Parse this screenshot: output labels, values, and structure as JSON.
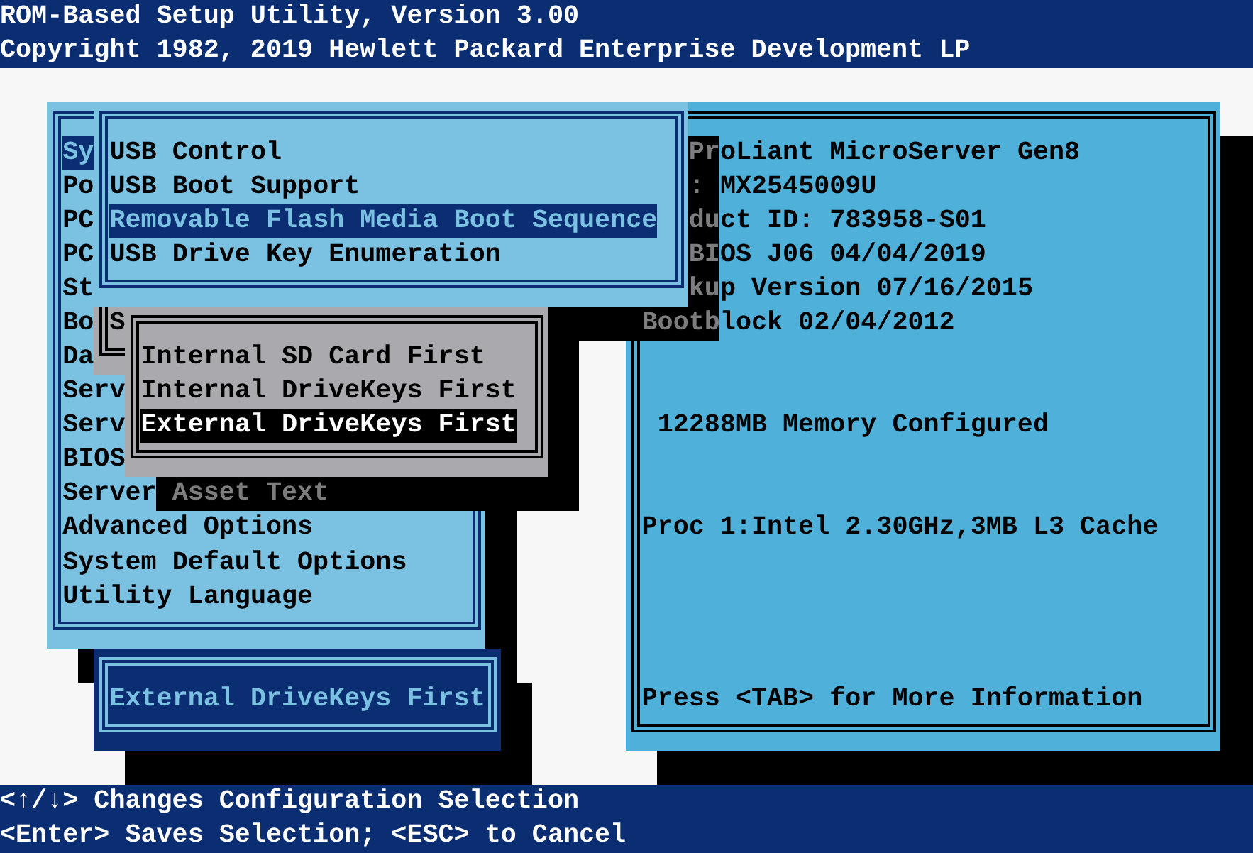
{
  "title_bar": {
    "lines": [
      "ROM-Based Setup Utility, Version 3.00",
      "Copyright 1982, 2019 Hewlett Packard Enterprise Development LP"
    ]
  },
  "main_menu": {
    "items": [
      {
        "label": "Sy",
        "selected": true
      },
      {
        "label": "Po",
        "selected": false
      },
      {
        "label": "PC",
        "selected": false
      },
      {
        "label": "PC",
        "selected": false
      },
      {
        "label": "St",
        "selected": false
      },
      {
        "label": "Bo",
        "selected": false
      },
      {
        "label": "Da",
        "selected": false
      },
      {
        "label": "Serv",
        "selected": false
      },
      {
        "label": "Serv",
        "selected": false
      },
      {
        "label": "BIOS",
        "selected": false
      },
      {
        "label": "Server Asset Text",
        "selected": false
      },
      {
        "label": "Advanced Options",
        "selected": false
      },
      {
        "label": "System Default Options",
        "selected": false
      },
      {
        "label": "Utility Language",
        "selected": false
      }
    ]
  },
  "usb_submenu": {
    "items": [
      {
        "label": "USB Control",
        "selected": false
      },
      {
        "label": "USB Boot Support",
        "selected": false
      },
      {
        "label": "Removable Flash Media Boot Sequence",
        "selected": true
      },
      {
        "label": "USB Drive Key Enumeration",
        "selected": false
      }
    ]
  },
  "partial_window": {
    "text": "S"
  },
  "options_popup": {
    "options": [
      {
        "label": "Internal SD Card First",
        "selected": false
      },
      {
        "label": "Internal DriveKeys First",
        "selected": false
      },
      {
        "label": "External DriveKeys First",
        "selected": true
      }
    ]
  },
  "value_box": {
    "text": "External DriveKeys First"
  },
  "info_panel": {
    "lines": [
      "ProLiant MicroServer Gen8",
      ": MX2545009U",
      "duct ID: 783958-S01",
      "BIOS J06 04/04/2019",
      "kup Version 07/16/2015",
      "Bootblock 02/04/2012",
      "12288MB Memory Configured",
      "Proc 1:Intel 2.30GHz,3MB L3 Cache",
      "Press <TAB> for More Information"
    ]
  },
  "help_bar": {
    "lines": [
      "<↑/↓> Changes Configuration Selection",
      "<Enter> Saves Selection; <ESC> to Cancel"
    ]
  }
}
